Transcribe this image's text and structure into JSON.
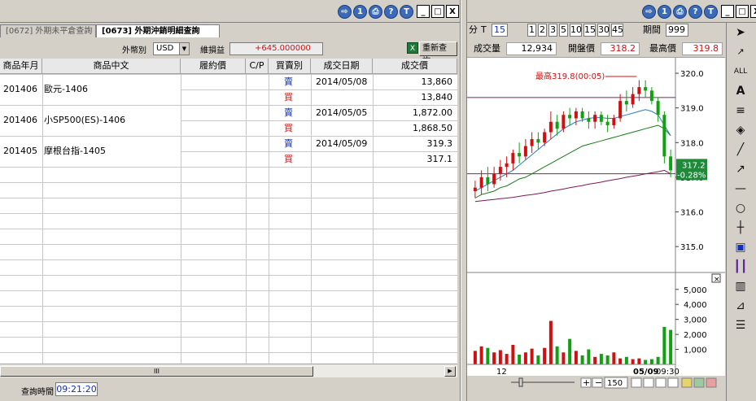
{
  "left_window": {
    "tabs": [
      {
        "label": "[0672] 外期未平倉查詢",
        "active": false
      },
      {
        "label": "[0673] 外期沖銷明細查詢",
        "active": true
      }
    ],
    "filter": {
      "currency_label": "外幣別",
      "currency_value": "USD",
      "pnl_label": "維損益",
      "pnl_value": "+645.000000",
      "excel_icon": "excel-export-icon",
      "refresh_button": "重新查詢"
    },
    "columns": [
      "商品年月",
      "商品中文",
      "履約價",
      "C/P",
      "買賣別",
      "成交日期",
      "成交價"
    ],
    "rows": [
      {
        "month": "201406",
        "name": "歐元-1406",
        "legs": [
          {
            "side": "賣",
            "date": "2014/05/08",
            "price": "13,860"
          },
          {
            "side": "買",
            "date": "",
            "price": "13,840"
          }
        ]
      },
      {
        "month": "201406",
        "name": "小SP500(ES)-1406",
        "legs": [
          {
            "side": "賣",
            "date": "2014/05/05",
            "price": "1,872.00"
          },
          {
            "side": "買",
            "date": "",
            "price": "1,868.50"
          }
        ]
      },
      {
        "month": "201405",
        "name": "摩根台指-1405",
        "legs": [
          {
            "side": "賣",
            "date": "2014/05/09",
            "price": "319.3"
          },
          {
            "side": "買",
            "date": "",
            "price": "317.1"
          }
        ]
      }
    ],
    "status": {
      "label": "查詢時間",
      "time": "09:21:20"
    },
    "scroll_grip": "III"
  },
  "title_buttons": {
    "right_arrow": "⇨",
    "one": "1",
    "print": "⎙",
    "help": "?",
    "t": "T",
    "min": "_",
    "max": "□",
    "close": "X"
  },
  "right_window": {
    "period_label_prefix": "分",
    "period_t": "T",
    "period_select": "15",
    "period_buttons": [
      "1",
      "2",
      "3",
      "5",
      "10",
      "15",
      "30",
      "45"
    ],
    "count_label": "期間",
    "count_value": "999",
    "info": [
      {
        "label": "成交量",
        "value": "12,934"
      },
      {
        "label": "開盤價",
        "value": "318.2"
      },
      {
        "label": "最高價",
        "value": "319.8"
      }
    ],
    "annotations": {
      "high_label": "最高319.8(00:05)",
      "last_price": "317.2",
      "last_change": "-0.28%",
      "x_label_left": "12",
      "x_label_date": "05/09",
      "x_label_time": "09:30",
      "zoom_value": "150"
    },
    "sidebar_icons": [
      "cursor-arrow-icon",
      "point-line-icon",
      "all-icon",
      "text-icon",
      "hlines-icon",
      "fill-icon",
      "diagonal-line-icon",
      "arrow-line-icon",
      "hline-icon",
      "circle-icon",
      "bar-icon",
      "candle-icon",
      "vbars-icon",
      "grid-icon",
      "fan-icon",
      "fib-icon"
    ]
  },
  "chart_data": {
    "type": "line",
    "title": "",
    "y_ticks": [
      315.0,
      316.0,
      317.0,
      318.0,
      319.0,
      320.0
    ],
    "ylim": [
      314.3,
      320.4
    ],
    "volume_ticks": [
      "5,000",
      "4,000",
      "3,000",
      "2,000",
      "1,000"
    ],
    "volume_ylim": [
      0,
      5800
    ],
    "reference_lines": [
      319.3,
      317.1
    ],
    "candles": [
      [
        316.6,
        316.9,
        316.4,
        316.7
      ],
      [
        316.7,
        317.2,
        316.5,
        317.0
      ],
      [
        317.0,
        317.3,
        316.6,
        316.8
      ],
      [
        316.8,
        317.3,
        316.7,
        317.1
      ],
      [
        317.1,
        317.5,
        316.9,
        317.3
      ],
      [
        317.3,
        317.6,
        317.0,
        317.4
      ],
      [
        317.4,
        317.8,
        317.2,
        317.7
      ],
      [
        317.7,
        318.0,
        317.4,
        317.6
      ],
      [
        317.6,
        318.1,
        317.5,
        317.9
      ],
      [
        317.9,
        318.3,
        317.7,
        318.1
      ],
      [
        318.1,
        318.3,
        317.8,
        318.0
      ],
      [
        318.0,
        318.4,
        317.9,
        318.3
      ],
      [
        318.3,
        318.9,
        318.1,
        318.6
      ],
      [
        318.6,
        318.8,
        318.2,
        318.4
      ],
      [
        318.4,
        318.9,
        318.3,
        318.8
      ],
      [
        318.8,
        319.0,
        318.5,
        318.7
      ],
      [
        318.7,
        319.0,
        318.5,
        318.9
      ],
      [
        318.9,
        319.0,
        318.6,
        318.7
      ],
      [
        318.7,
        318.9,
        318.4,
        318.6
      ],
      [
        318.6,
        318.9,
        318.4,
        318.8
      ],
      [
        318.8,
        318.9,
        318.5,
        318.6
      ],
      [
        318.6,
        318.8,
        318.3,
        318.5
      ],
      [
        318.5,
        318.8,
        318.4,
        318.7
      ],
      [
        318.7,
        319.4,
        318.6,
        319.2
      ],
      [
        319.2,
        319.5,
        318.9,
        319.1
      ],
      [
        319.1,
        319.6,
        319.0,
        319.4
      ],
      [
        319.4,
        319.8,
        319.2,
        319.6
      ],
      [
        319.6,
        319.8,
        319.3,
        319.5
      ],
      [
        319.5,
        319.6,
        319.1,
        319.2
      ],
      [
        319.2,
        319.3,
        318.6,
        318.8
      ],
      [
        318.8,
        318.9,
        317.4,
        317.6
      ],
      [
        317.6,
        317.8,
        317.0,
        317.2
      ]
    ],
    "volume": [
      900,
      1200,
      1100,
      800,
      950,
      700,
      1300,
      650,
      800,
      1050,
      600,
      1100,
      2900,
      1200,
      800,
      1700,
      900,
      600,
      1000,
      500,
      700,
      600,
      800,
      400,
      500,
      350,
      400,
      300,
      350,
      500,
      2500,
      2300
    ],
    "ma_blue": [
      316.6,
      316.7,
      316.8,
      316.9,
      317.0,
      317.1,
      317.2,
      317.35,
      317.5,
      317.65,
      317.8,
      317.95,
      318.1,
      318.25,
      318.4,
      318.5,
      318.6,
      318.65,
      318.7,
      318.72,
      318.72,
      318.7,
      318.7,
      318.75,
      318.8,
      318.85,
      318.9,
      318.95,
      318.9,
      318.8,
      318.5,
      318.2
    ],
    "ma_green": [
      316.4,
      316.5,
      316.55,
      316.6,
      316.7,
      316.75,
      316.85,
      316.95,
      317.0,
      317.1,
      317.2,
      317.3,
      317.4,
      317.5,
      317.6,
      317.7,
      317.8,
      317.9,
      317.95,
      318.0,
      318.05,
      318.1,
      318.15,
      318.2,
      318.25,
      318.3,
      318.35,
      318.4,
      318.45,
      318.5,
      318.4,
      318.2
    ],
    "ma_purple": [
      316.3,
      316.32,
      316.34,
      316.36,
      316.38,
      316.4,
      316.42,
      316.45,
      316.48,
      316.5,
      316.53,
      316.56,
      316.6,
      316.63,
      316.66,
      316.7,
      316.73,
      316.76,
      316.8,
      316.83,
      316.86,
      316.9,
      316.93,
      316.96,
      317.0,
      317.03,
      317.06,
      317.1,
      317.13,
      317.16,
      317.2,
      317.1
    ]
  }
}
